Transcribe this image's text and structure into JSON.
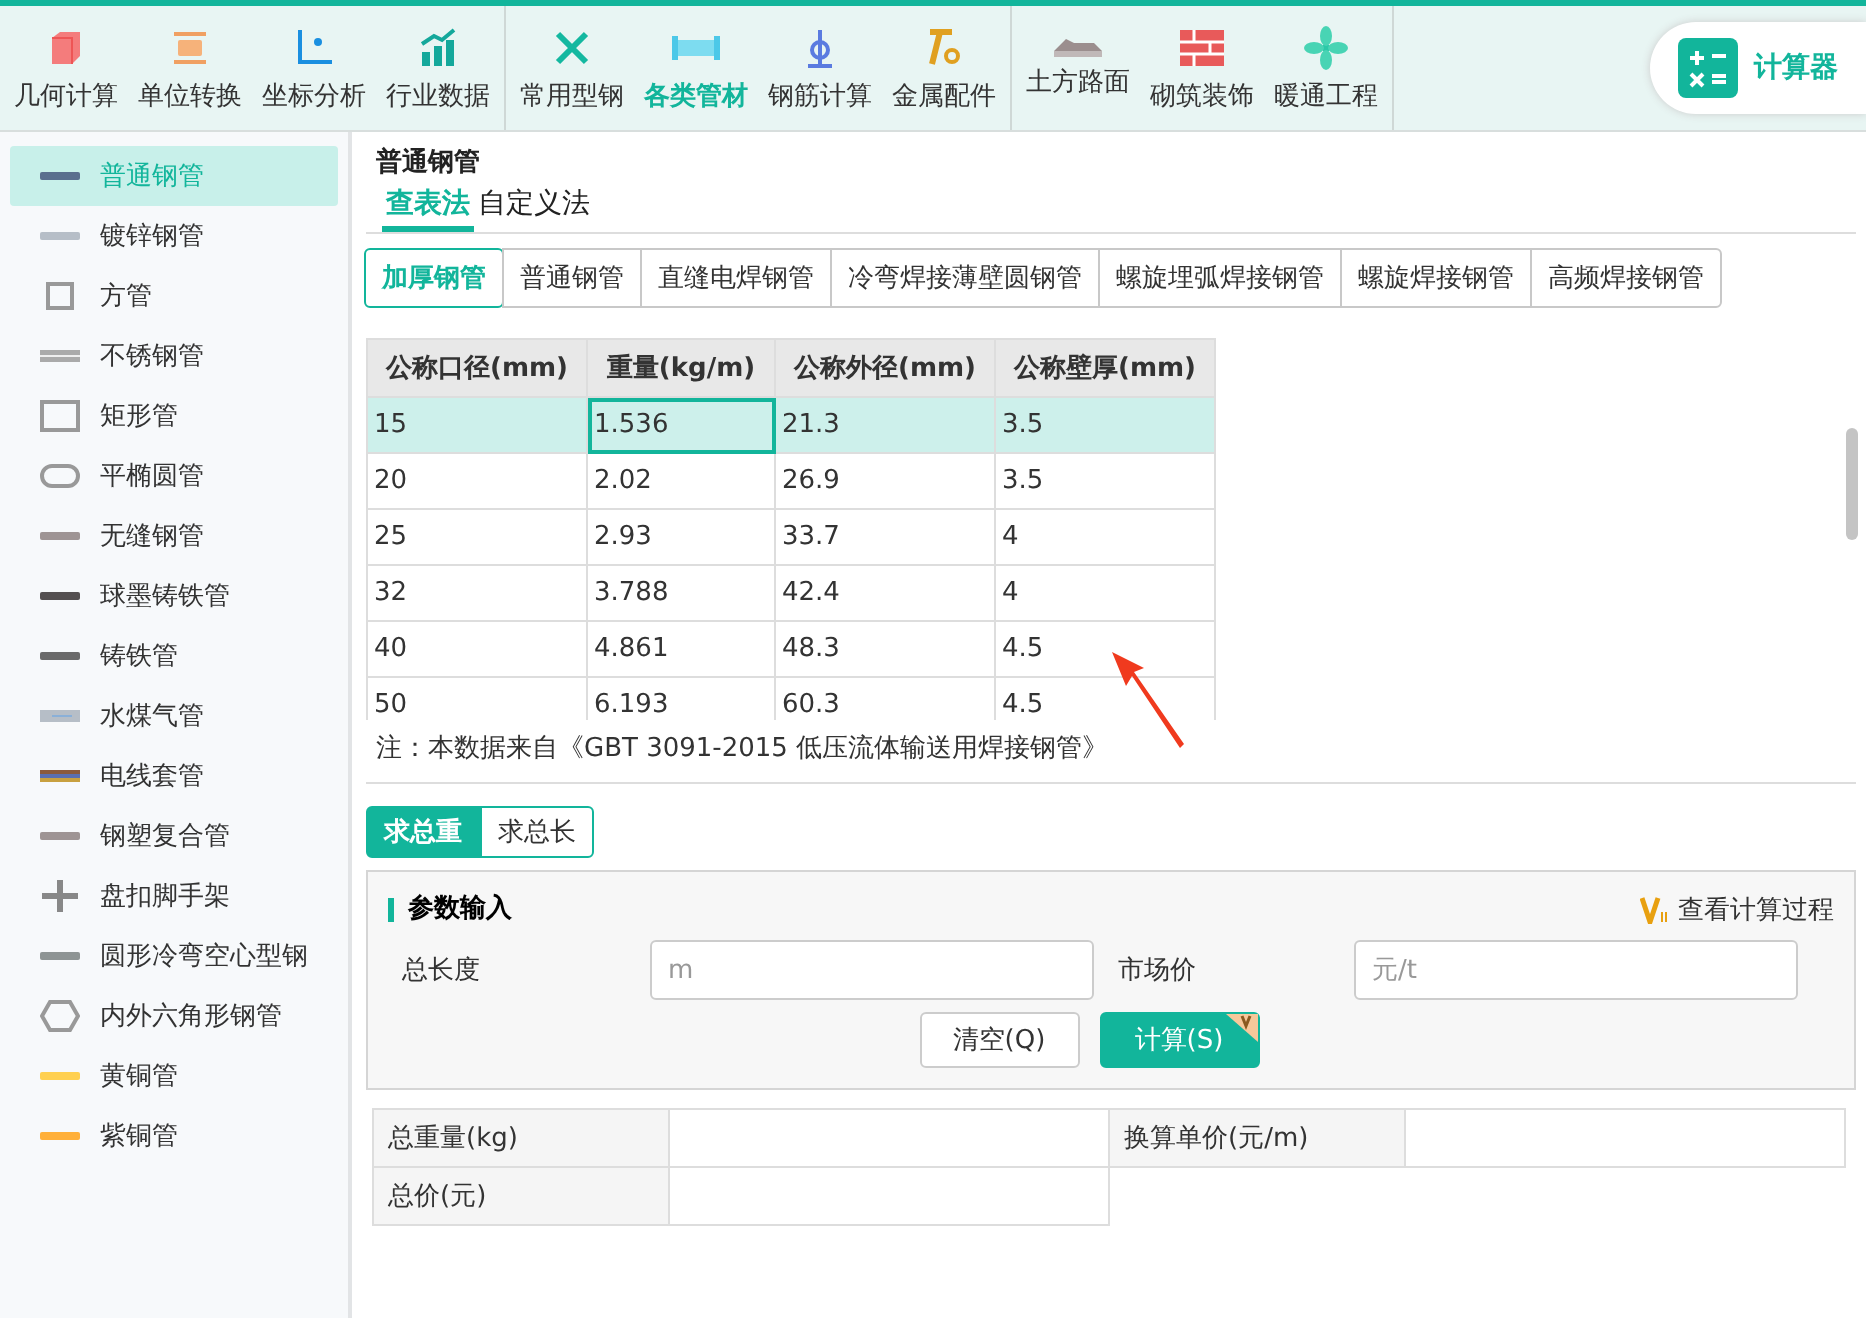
{
  "toolbar": {
    "groups": [
      {
        "items": [
          {
            "label": "几何计算",
            "selected": false
          },
          {
            "label": "单位转换",
            "selected": false
          },
          {
            "label": "坐标分析",
            "selected": false
          },
          {
            "label": "行业数据",
            "selected": false
          }
        ]
      },
      {
        "items": [
          {
            "label": "常用型钢",
            "selected": false
          },
          {
            "label": "各类管材",
            "selected": true
          },
          {
            "label": "钢筋计算",
            "selected": false
          },
          {
            "label": "金属配件",
            "selected": false
          }
        ]
      },
      {
        "items": [
          {
            "label": "土方路面",
            "selected": false
          },
          {
            "label": "砌筑装饰",
            "selected": false
          },
          {
            "label": "暖通工程",
            "selected": false
          }
        ]
      }
    ],
    "calculator": "计算器"
  },
  "sidebar": {
    "items": [
      {
        "label": "普通钢管",
        "selected": true
      },
      {
        "label": "镀锌钢管",
        "selected": false
      },
      {
        "label": "方管",
        "selected": false
      },
      {
        "label": "不锈钢管",
        "selected": false
      },
      {
        "label": "矩形管",
        "selected": false
      },
      {
        "label": "平椭圆管",
        "selected": false
      },
      {
        "label": "无缝钢管",
        "selected": false
      },
      {
        "label": "球墨铸铁管",
        "selected": false
      },
      {
        "label": "铸铁管",
        "selected": false
      },
      {
        "label": "水煤气管",
        "selected": false
      },
      {
        "label": "电线套管",
        "selected": false
      },
      {
        "label": "钢塑复合管",
        "selected": false
      },
      {
        "label": "盘扣脚手架",
        "selected": false
      },
      {
        "label": "圆形冷弯空心型钢",
        "selected": false
      },
      {
        "label": "内外六角形钢管",
        "selected": false
      },
      {
        "label": "黄铜管",
        "selected": false
      },
      {
        "label": "紫铜管",
        "selected": false
      }
    ]
  },
  "content": {
    "title": "普通钢管",
    "method_tabs": [
      {
        "label": "查表法",
        "selected": true
      },
      {
        "label": "自定义法",
        "selected": false
      }
    ],
    "type_tabs": [
      {
        "label": "加厚钢管",
        "selected": true
      },
      {
        "label": "普通钢管",
        "selected": false
      },
      {
        "label": "直缝电焊钢管",
        "selected": false
      },
      {
        "label": "冷弯焊接薄壁圆钢管",
        "selected": false
      },
      {
        "label": "螺旋埋弧焊接钢管",
        "selected": false
      },
      {
        "label": "螺旋焊接钢管",
        "selected": false
      },
      {
        "label": "高频焊接钢管",
        "selected": false
      }
    ],
    "table": {
      "columns": [
        "公称口径(mm)",
        "重量(kg/m)",
        "公称外径(mm)",
        "公称壁厚(mm)"
      ],
      "rows": [
        {
          "cells": [
            "15",
            "1.536",
            "21.3",
            "3.5"
          ],
          "selected": true
        },
        {
          "cells": [
            "20",
            "2.02",
            "26.9",
            "3.5"
          ],
          "selected": false
        },
        {
          "cells": [
            "25",
            "2.93",
            "33.7",
            "4"
          ],
          "selected": false
        },
        {
          "cells": [
            "32",
            "3.788",
            "42.4",
            "4"
          ],
          "selected": false
        },
        {
          "cells": [
            "40",
            "4.861",
            "48.3",
            "4.5"
          ],
          "selected": false
        },
        {
          "cells": [
            "50",
            "6.193",
            "60.3",
            "4.5"
          ],
          "selected": false
        }
      ]
    },
    "note": "注：本数据来自《GBT 3091-2015 低压流体输送用焊接钢管》",
    "calc_tabs": [
      {
        "label": "求总重",
        "selected": true
      },
      {
        "label": "求总长",
        "selected": false
      }
    ],
    "params": {
      "title": "参数输入",
      "view_process": "查看计算过程",
      "fields": [
        {
          "label": "总长度",
          "placeholder": "m"
        },
        {
          "label": "市场价",
          "placeholder": "元/t"
        }
      ],
      "buttons": [
        {
          "label": "清空(Q)",
          "kind": "secondary"
        },
        {
          "label": "计算(S)",
          "kind": "primary"
        }
      ]
    },
    "results": [
      {
        "label": "总重量(kg)",
        "value_label": "换算单价(元/m)"
      },
      {
        "label": "总价(元)"
      }
    ]
  }
}
